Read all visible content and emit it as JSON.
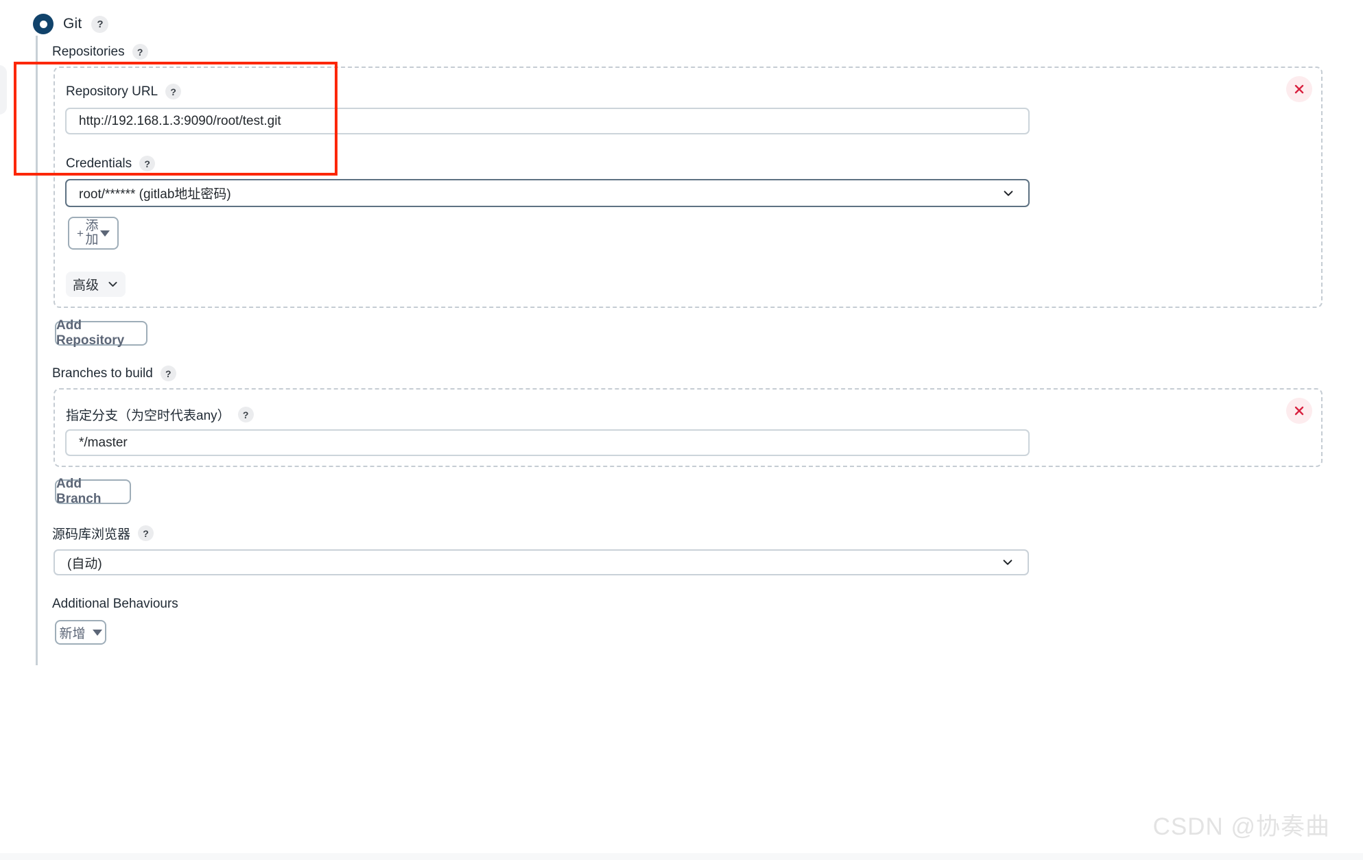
{
  "scm": {
    "selected_option": "Git",
    "help_symbol": "?"
  },
  "repositories": {
    "label": "Repositories",
    "repo_url": {
      "label": "Repository URL",
      "value": "http://192.168.1.3:9090/root/test.git"
    },
    "credentials": {
      "label": "Credentials",
      "value": "root/****** (gitlab地址密码)",
      "add_button": {
        "plus": "+",
        "label": "添加"
      }
    },
    "advanced_button": "高级",
    "add_repository_button": "Add Repository",
    "delete_icon_title": "Delete repository"
  },
  "branches": {
    "label": "Branches to build",
    "specifier": {
      "label": "指定分支（为空时代表any）",
      "value": "*/master"
    },
    "add_branch_button": "Add Branch",
    "delete_icon_title": "Delete branch"
  },
  "source_browser": {
    "label": "源码库浏览器",
    "value": "(自动)"
  },
  "additional_behaviours": {
    "label": "Additional Behaviours",
    "add_button": "新增"
  },
  "watermark": "CSDN @协奏曲",
  "colors": {
    "radio_fill": "#11436b",
    "annotation": "#fc2703",
    "delete_x": "#d8213f",
    "delete_bg": "#fdecee",
    "rail": "#c8d0d6",
    "dashed_border": "#c5ccd3"
  }
}
